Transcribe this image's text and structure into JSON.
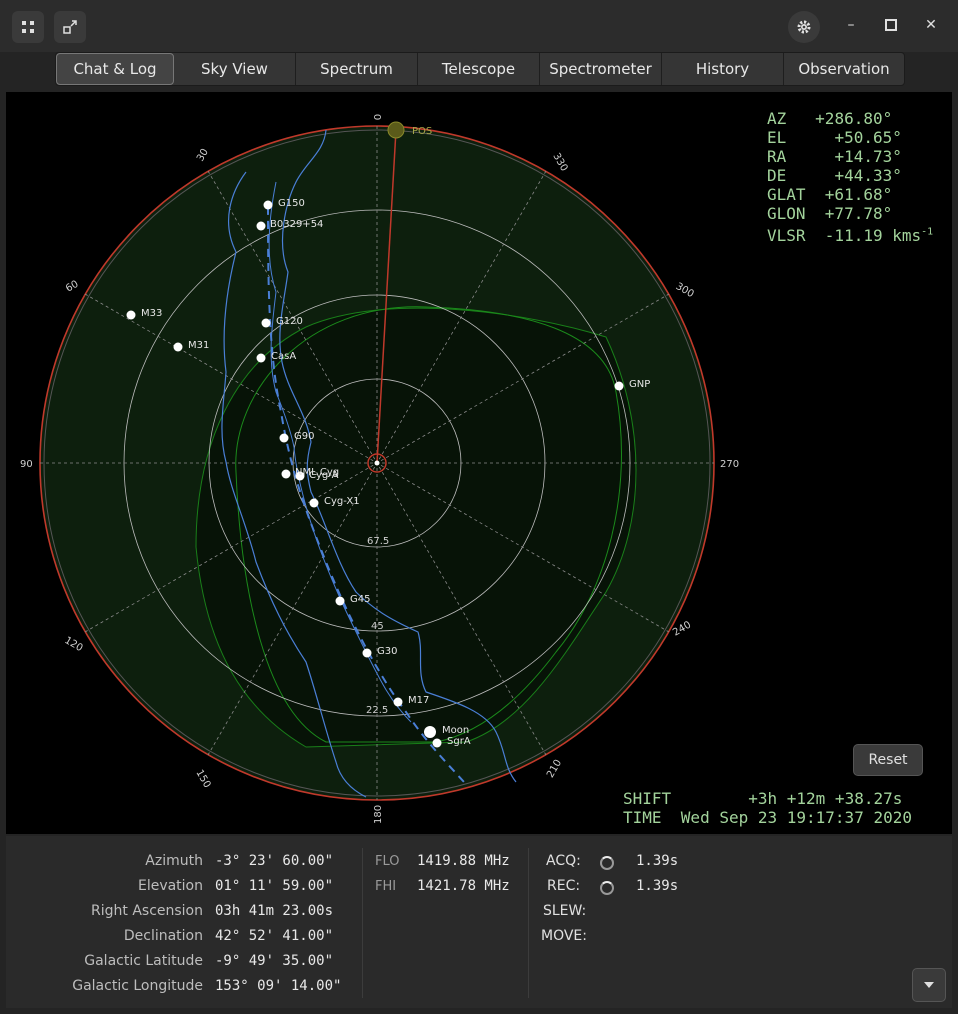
{
  "window": {
    "apps_icon": "grid-icon",
    "restore_icon": "restore-icon",
    "settings_icon": "gear-icon",
    "minimize": "–",
    "maximize": "□",
    "close": "✕"
  },
  "tabs": [
    {
      "label": "Chat & Log",
      "active": true
    },
    {
      "label": "Sky View",
      "active": false
    },
    {
      "label": "Spectrum",
      "active": false
    },
    {
      "label": "Telescope",
      "active": false
    },
    {
      "label": "Spectrometer",
      "active": false
    },
    {
      "label": "History",
      "active": false
    },
    {
      "label": "Observation",
      "active": false
    }
  ],
  "sky": {
    "azimuth_labels": [
      "0",
      "30",
      "60",
      "90",
      "120",
      "150",
      "180",
      "210",
      "240",
      "270",
      "300",
      "330"
    ],
    "elevation_labels": [
      "67.5",
      "45",
      "22.5"
    ],
    "pos_label": "POS",
    "objects": [
      "G150",
      "B0329+54",
      "M33",
      "M31",
      "G120",
      "CasA",
      "G90",
      "NML Cyg",
      "Cyg-A",
      "Cyg-X1",
      "G45",
      "G30",
      "M17",
      "Moon",
      "SgrA",
      "GNP"
    ],
    "colors": {
      "horizon": "#c0392b",
      "galactic_plane": "#4a7fd6",
      "visible_region": "#0f2a0f",
      "pointer": "#c0392b",
      "readout": "#a3d39c"
    }
  },
  "readout": {
    "az_label": "AZ",
    "az_value": "+286.80°",
    "el_label": "EL",
    "el_value": "+50.65°",
    "ra_label": "RA",
    "ra_value": "+14.73°",
    "de_label": "DE",
    "de_value": "+44.33°",
    "glat_label": "GLAT",
    "glat_value": "+61.68°",
    "glon_label": "GLON",
    "glon_value": "+77.78°",
    "vlsr_label": "VLSR",
    "vlsr_value": "-11.19 kms",
    "vlsr_sup": "-1",
    "shift_label": "SHIFT",
    "shift_value": "+3h +12m +38.27s",
    "time_label": "TIME",
    "time_value": "Wed Sep 23 19:17:37 2020"
  },
  "reset_label": "Reset",
  "coords": [
    {
      "label": "Azimuth",
      "value": "-3° 23' 60.00\""
    },
    {
      "label": "Elevation",
      "value": "01° 11' 59.00\""
    },
    {
      "label": "Right Ascension",
      "value": "03h 41m 23.00s"
    },
    {
      "label": "Declination",
      "value": "42° 52' 41.00\""
    },
    {
      "label": "Galactic Latitude",
      "value": "-9° 49' 35.00\""
    },
    {
      "label": "Galactic Longitude",
      "value": "153° 09' 14.00\""
    }
  ],
  "freq": {
    "flo_label": "FLO",
    "flo_value": "1419.88 MHz",
    "fhi_label": "FHI",
    "fhi_value": "1421.78 MHz"
  },
  "status": {
    "acq_label": "ACQ:",
    "acq_value": "1.39s",
    "rec_label": "REC:",
    "rec_value": "1.39s",
    "slew_label": "SLEW:",
    "move_label": "MOVE:"
  },
  "menu_icon": "chevron-down-icon"
}
